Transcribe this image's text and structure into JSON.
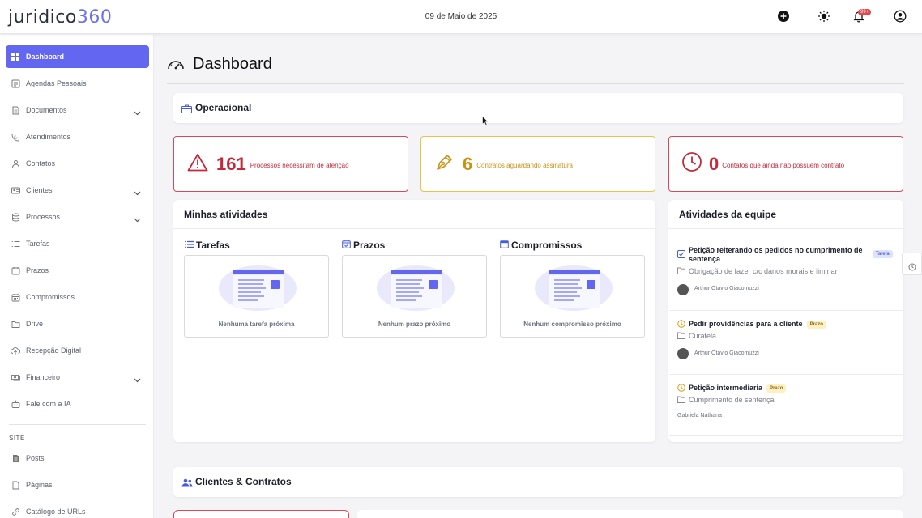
{
  "app": {
    "logo_main": "juridico",
    "logo_num": "360",
    "date": "09 de Maio de 2025",
    "notif_badge": "99+"
  },
  "sidebar": {
    "items": [
      {
        "label": "Dashboard",
        "icon": "dashboard-icon"
      },
      {
        "label": "Agendas Pessoais",
        "icon": "agenda-icon"
      },
      {
        "label": "Documentos",
        "icon": "document-icon"
      },
      {
        "label": "Atendimentos",
        "icon": "phone-icon"
      },
      {
        "label": "Contatos",
        "icon": "user-icon"
      },
      {
        "label": "Clientes",
        "icon": "id-card-icon"
      },
      {
        "label": "Processos",
        "icon": "database-icon"
      },
      {
        "label": "Tarefas",
        "icon": "list-icon"
      },
      {
        "label": "Prazos",
        "icon": "calendar-check-icon"
      },
      {
        "label": "Compromissos",
        "icon": "calendar-icon"
      },
      {
        "label": "Drive",
        "icon": "folder-icon"
      },
      {
        "label": "Recepção Digital",
        "icon": "cloud-upload-icon"
      },
      {
        "label": "Financeiro",
        "icon": "money-icon"
      },
      {
        "label": "Fale com a IA",
        "icon": "robot-icon"
      }
    ],
    "site_label": "SITE",
    "site_items": [
      {
        "label": "Posts",
        "icon": "file-text-icon"
      },
      {
        "label": "Páginas",
        "icon": "file-icon"
      },
      {
        "label": "Catálogo de URLs",
        "icon": "link-icon"
      }
    ]
  },
  "main": {
    "title": "Dashboard",
    "operacional_title": "Operacional",
    "stats": [
      {
        "value": "161",
        "text": "Processos necessitam de atenção",
        "color": "#c62839",
        "border": "#d9485a"
      },
      {
        "value": "6",
        "text": "Contratos aguardando assinatura",
        "color": "#c89215",
        "border": "#e9c24a"
      },
      {
        "value": "0",
        "text": "Contatos que ainda não possuem contrato",
        "color": "#c62839",
        "border": "#d9485a"
      }
    ],
    "minhas_title": "Minhas atividades",
    "columns": [
      {
        "title": "Tarefas",
        "empty": "Nenhuma tarefa próxima"
      },
      {
        "title": "Prazos",
        "empty": "Nenhum prazo próximo"
      },
      {
        "title": "Compromissos",
        "empty": "Nenhum compromisso próximo"
      }
    ],
    "equipe_title": "Atividades da equipe",
    "equipe": [
      {
        "title": "Petição reiterando os pedidos no cumprimento de sentença",
        "tag": "Tarefa",
        "sub": "Obrigação de fazer c/c danos morais e liminar",
        "person": "Arthur Otávio Giacomuzzi"
      },
      {
        "title": "Pedir providências para a cliente",
        "tag": "Prazo",
        "sub": "Curatela",
        "person": "Arthur Otávio Giacomuzzi"
      },
      {
        "title": "Petição intermediaria",
        "tag": "Prazo",
        "sub": "Cumprimento de sentença",
        "person": "Gabriela Nathana"
      }
    ],
    "clientes_title": "Clientes & Contratos"
  },
  "colors": {
    "accent": "#6366f1"
  }
}
